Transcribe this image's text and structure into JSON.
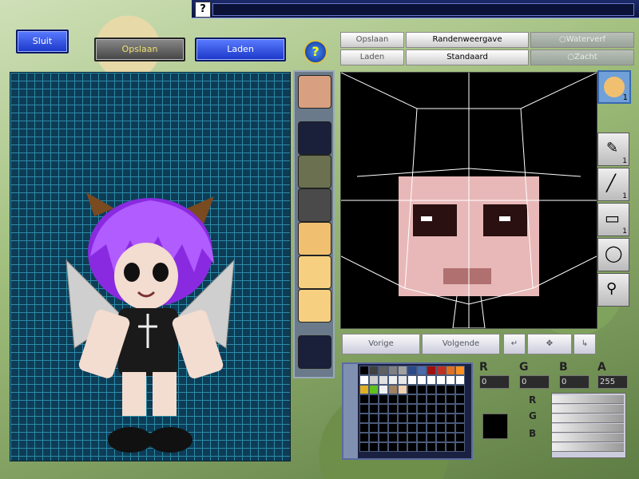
{
  "top_help_label": "?",
  "left_buttons": {
    "close": "Sluit",
    "save": "Opslaan",
    "load": "Laden"
  },
  "help_label": "?",
  "right_buttons": {
    "save": "Opslaan",
    "load": "Laden",
    "edge_view": "Randenweergave",
    "standard": "Standaard",
    "watercolor": "Waterverf",
    "soft": "Zacht"
  },
  "nav": {
    "prev": "Vorige",
    "next": "Volgende"
  },
  "tool_counts": [
    "1",
    "1",
    "1"
  ],
  "preview_count": "1",
  "channels": [
    {
      "label": "R",
      "value": "0"
    },
    {
      "label": "G",
      "value": "0"
    },
    {
      "label": "B",
      "value": "0"
    },
    {
      "label": "A",
      "value": "255"
    }
  ],
  "hsb_labels": [
    "R",
    "G",
    "B"
  ],
  "palette": [
    "#000000",
    "#404040",
    "#606060",
    "#808080",
    "#a0a0a0",
    "#2a4a8a",
    "#4a6aaa",
    "#a01010",
    "#c03020",
    "#e07020",
    "#ff9020",
    "#ffffff",
    "#d0d0d0",
    "#e0e0e0",
    "#f0f0f0",
    "#e8e8e8",
    "#ffffff",
    "#ffffff",
    "#ffffff",
    "#ffffff",
    "#ffffff",
    "#ffffff",
    "#e0b020",
    "#60c020",
    "#f0f0f0",
    "#a08060",
    "#f0d0b0",
    "#000000",
    "#000000",
    "#000000",
    "#000000",
    "#000000",
    "#000000"
  ]
}
